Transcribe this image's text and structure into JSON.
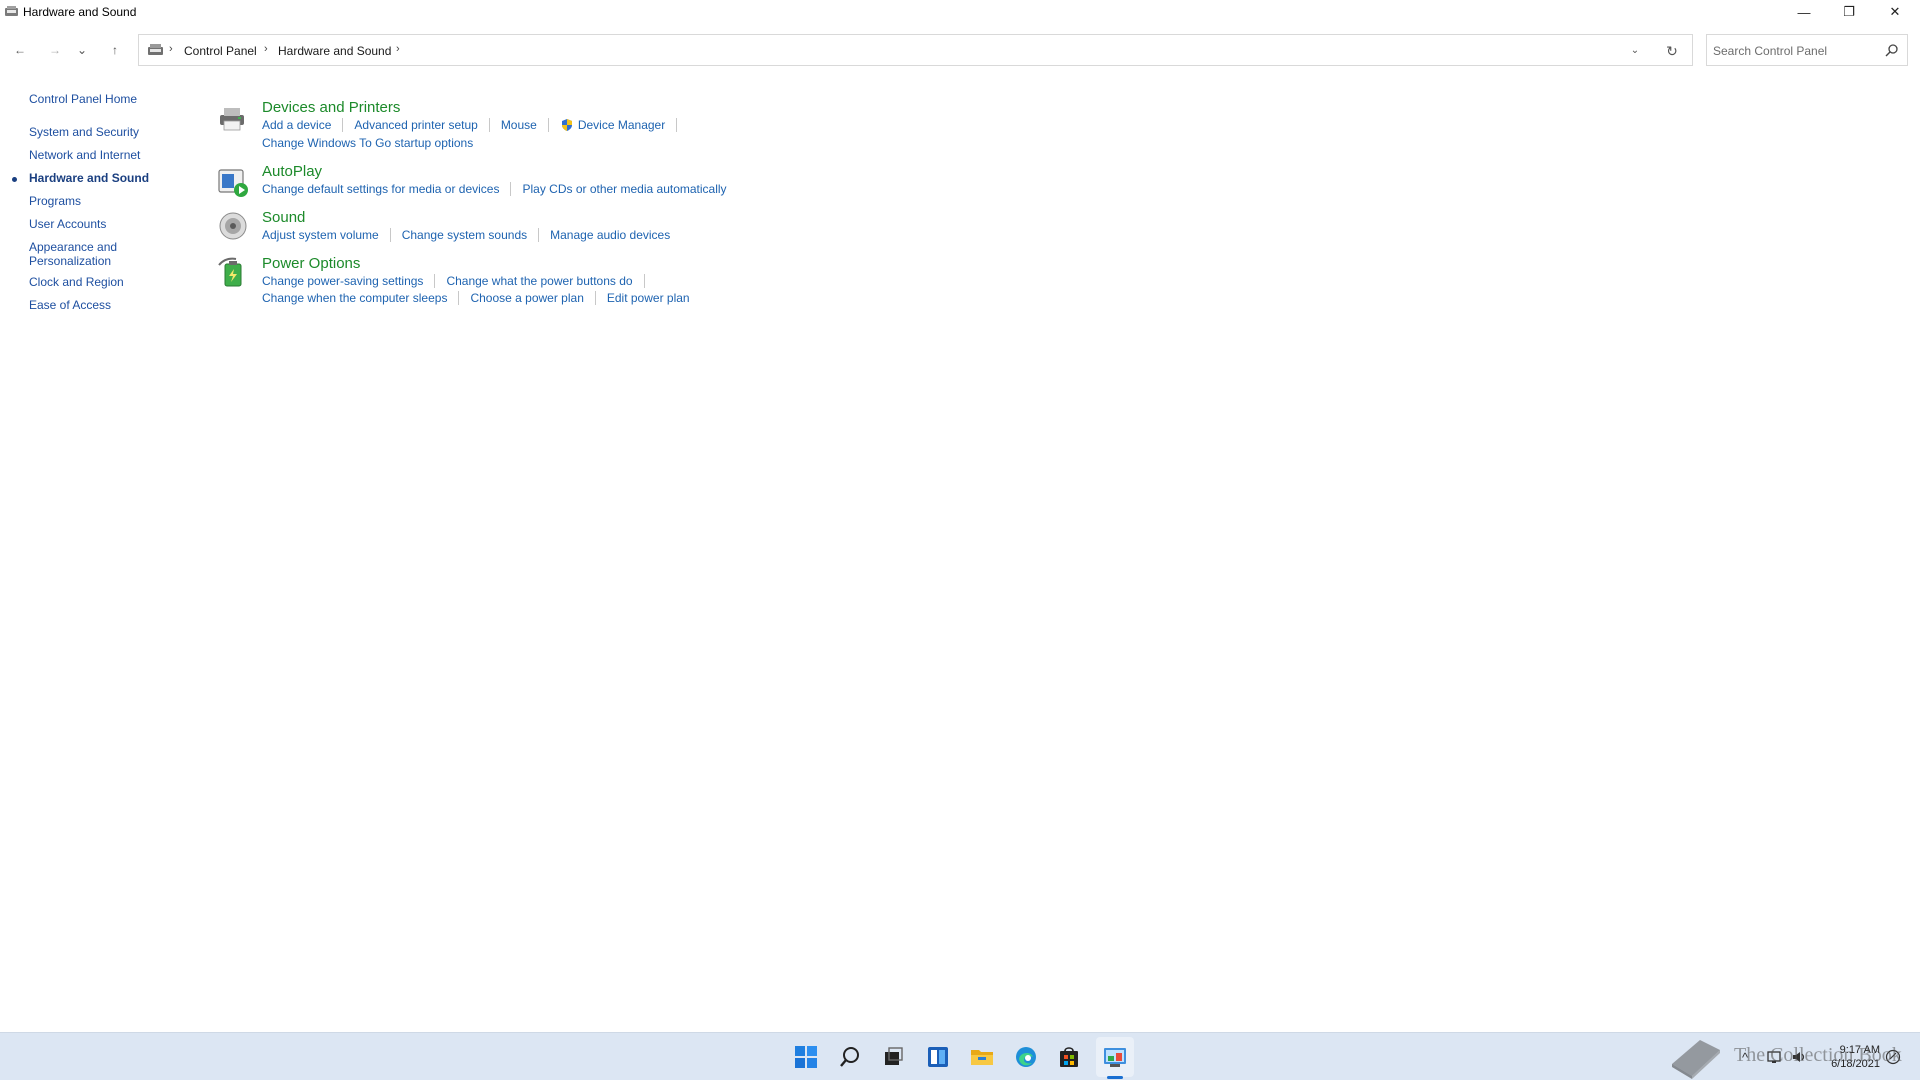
{
  "window": {
    "title": "Hardware and Sound",
    "minimize_glyph": "—",
    "maximize_glyph": "❐",
    "close_glyph": "✕"
  },
  "nav": {
    "back_glyph": "←",
    "forward_glyph": "→",
    "recent_glyph": "⌄",
    "up_glyph": "↑"
  },
  "address": {
    "sep_glyph": "›",
    "crumbs": [
      "Control Panel",
      "Hardware and Sound"
    ],
    "dropdown_glyph": "⌄",
    "refresh_glyph": "↻"
  },
  "search": {
    "placeholder": "Search Control Panel"
  },
  "leftnav": {
    "home": "Control Panel Home",
    "items": [
      "System and Security",
      "Network and Internet",
      "Hardware and Sound",
      "Programs",
      "User Accounts",
      "Appearance and",
      "Personalization",
      "Clock and Region",
      "Ease of Access"
    ]
  },
  "sections": [
    {
      "title": "Devices and Printers",
      "icon": "printer-icon",
      "rows": [
        [
          "Add a device",
          "Advanced printer setup",
          "Mouse",
          "Device Manager"
        ],
        [
          "Change Windows To Go startup options"
        ]
      ]
    },
    {
      "title": "AutoPlay",
      "icon": "autoplay-icon",
      "rows": [
        [
          "Change default settings for media or devices",
          "Play CDs or other media automatically"
        ]
      ]
    },
    {
      "title": "Sound",
      "icon": "speaker-icon",
      "rows": [
        [
          "Adjust system volume",
          "Change system sounds",
          "Manage audio devices"
        ]
      ]
    },
    {
      "title": "Power Options",
      "icon": "battery-icon",
      "rows": [
        [
          "Change power-saving settings",
          "Change what the power buttons do"
        ],
        [
          "Change when the computer sleeps",
          "Choose a power plan",
          "Edit power plan"
        ]
      ]
    }
  ],
  "taskbar": {
    "icons": [
      "start-icon",
      "search-icon",
      "task-view-icon",
      "widgets-icon",
      "file-explorer-icon",
      "edge-icon",
      "store-icon",
      "control-panel-icon"
    ],
    "tray_chevron": "^",
    "clock_time": "9:17 AM",
    "clock_date": "6/18/2021",
    "watermark_text": "The Collection Book"
  },
  "colors": {
    "link": "#1e63b0",
    "section_title": "#1c8a2a",
    "nav_link": "#1e4fa0",
    "taskbar_bg": "#dce6f3"
  }
}
